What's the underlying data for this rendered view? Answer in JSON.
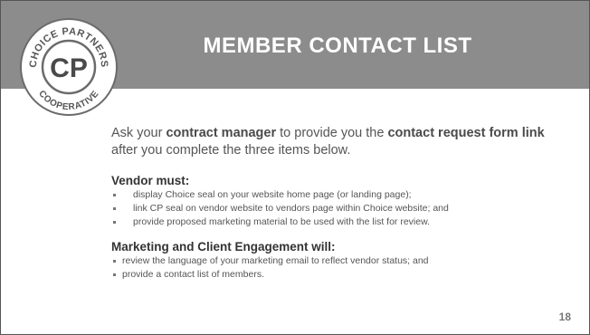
{
  "slide": {
    "title": "MEMBER  CONTACT LIST",
    "logo": {
      "top_text": "CHOICE PARTNERS",
      "monogram": "CP",
      "bottom_text": "COOPERATIVE"
    },
    "intro": {
      "part1": "Ask your ",
      "bold1": "contract manager",
      "part2": " to provide you the ",
      "bold2": "contact request form link",
      "part3": " after you complete the three items below."
    },
    "vendor_section": {
      "heading": "Vendor must:",
      "items": [
        "display  Choice seal on your website home page (or landing  page);",
        "link CP seal on vendor  website to vendors page within Choice website; and",
        "provide proposed marketing material  to be used with the list for review."
      ]
    },
    "marketing_section": {
      "heading": "Marketing  and Client Engagement  will:",
      "items": [
        "review the language of your marketing email to reflect vendor status; and",
        "provide  a contact list of members."
      ]
    },
    "page_number": "18",
    "colors": {
      "header_band": "#8c8c8c",
      "title_text": "#ffffff",
      "body_text": "#555555"
    }
  }
}
